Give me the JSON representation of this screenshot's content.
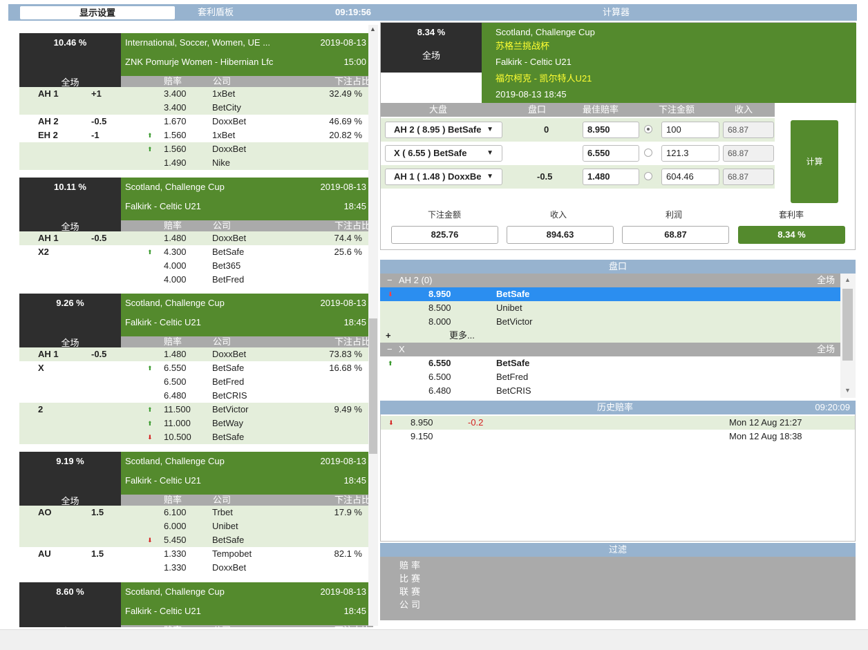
{
  "topbar": {
    "tab_display": "显示设置",
    "tab_arb": "套利盾板",
    "clock": "09:19:56",
    "calc_title": "计算器"
  },
  "colhdr": {
    "full": "全场",
    "odds": "赔率",
    "company": "公司",
    "share": "下注占比"
  },
  "blocks": [
    {
      "pct": "10.46 %",
      "league": "International, Soccer, Women, UE ...",
      "date": "2019-08-13",
      "match": "ZNK Pomurje Women - Hibernian Lfc",
      "time": "15:00",
      "rows": [
        {
          "mk": "AH 1",
          "ln": "+1",
          "arrow": "",
          "odds": "3.400",
          "book": "1xBet",
          "share": "32.49 %"
        },
        {
          "mk": "",
          "ln": "",
          "arrow": "",
          "odds": "3.400",
          "book": "BetCity",
          "share": ""
        },
        {
          "mk": "AH 2",
          "ln": "-0.5",
          "arrow": "",
          "odds": "1.670",
          "book": "DoxxBet",
          "share": "46.69 %"
        },
        {
          "mk": "EH 2",
          "ln": "-1",
          "arrow": "up",
          "odds": "1.560",
          "book": "1xBet",
          "share": "20.82 %"
        },
        {
          "mk": "",
          "ln": "",
          "arrow": "up",
          "odds": "1.560",
          "book": "DoxxBet",
          "share": ""
        },
        {
          "mk": "",
          "ln": "",
          "arrow": "",
          "odds": "1.490",
          "book": "Nike",
          "share": ""
        }
      ]
    },
    {
      "pct": "10.11 %",
      "league": "Scotland, Challenge Cup",
      "date": "2019-08-13",
      "match": "Falkirk - Celtic U21",
      "time": "18:45",
      "rows": [
        {
          "mk": "AH 1",
          "ln": "-0.5",
          "arrow": "",
          "odds": "1.480",
          "book": "DoxxBet",
          "share": "74.4 %"
        },
        {
          "mk": "X2",
          "ln": "",
          "arrow": "up",
          "odds": "4.300",
          "book": "BetSafe",
          "share": "25.6 %"
        },
        {
          "mk": "",
          "ln": "",
          "arrow": "",
          "odds": "4.000",
          "book": "Bet365",
          "share": ""
        },
        {
          "mk": "",
          "ln": "",
          "arrow": "",
          "odds": "4.000",
          "book": "BetFred",
          "share": ""
        }
      ]
    },
    {
      "pct": "9.26 %",
      "league": "Scotland, Challenge Cup",
      "date": "2019-08-13",
      "match": "Falkirk - Celtic U21",
      "time": "18:45",
      "rows": [
        {
          "mk": "AH 1",
          "ln": "-0.5",
          "arrow": "",
          "odds": "1.480",
          "book": "DoxxBet",
          "share": "73.83 %"
        },
        {
          "mk": "X",
          "ln": "",
          "arrow": "up",
          "odds": "6.550",
          "book": "BetSafe",
          "share": "16.68 %"
        },
        {
          "mk": "",
          "ln": "",
          "arrow": "",
          "odds": "6.500",
          "book": "BetFred",
          "share": ""
        },
        {
          "mk": "",
          "ln": "",
          "arrow": "",
          "odds": "6.480",
          "book": "BetCRIS",
          "share": ""
        },
        {
          "mk": "2",
          "ln": "",
          "arrow": "up",
          "odds": "11.500",
          "book": "BetVictor",
          "share": "9.49 %"
        },
        {
          "mk": "",
          "ln": "",
          "arrow": "up",
          "odds": "11.000",
          "book": "BetWay",
          "share": ""
        },
        {
          "mk": "",
          "ln": "",
          "arrow": "down",
          "odds": "10.500",
          "book": "BetSafe",
          "share": ""
        }
      ]
    },
    {
      "pct": "9.19 %",
      "league": "Scotland, Challenge Cup",
      "date": "2019-08-13",
      "match": "Falkirk - Celtic U21",
      "time": "18:45",
      "rows": [
        {
          "mk": "AO",
          "ln": "1.5",
          "arrow": "",
          "odds": "6.100",
          "book": "Trbet",
          "share": "17.9 %"
        },
        {
          "mk": "",
          "ln": "",
          "arrow": "",
          "odds": "6.000",
          "book": "Unibet",
          "share": ""
        },
        {
          "mk": "",
          "ln": "",
          "arrow": "down",
          "odds": "5.450",
          "book": "BetSafe",
          "share": ""
        },
        {
          "mk": "AU",
          "ln": "1.5",
          "arrow": "",
          "odds": "1.330",
          "book": "Tempobet",
          "share": "82.1 %"
        },
        {
          "mk": "",
          "ln": "",
          "arrow": "",
          "odds": "1.330",
          "book": "DoxxBet",
          "share": ""
        }
      ]
    },
    {
      "pct": "8.60 %",
      "league": "Scotland, Challenge Cup",
      "date": "2019-08-13",
      "match": "Falkirk - Celtic U21",
      "time": "18:45",
      "rows": []
    }
  ],
  "calc": {
    "pct": "8.34 %",
    "full": "全场",
    "league_en": "Scotland, Challenge Cup",
    "league_cn": "苏格兰挑战杯",
    "match_en": "Falkirk - Celtic U21",
    "match_cn": "福尔柯克 - 凯尔特人U21",
    "datetime": "2019-08-13 18:45",
    "hdr": {
      "market": "大盘",
      "line": "盘口",
      "best": "最佳赔率",
      "stake": "下注金额",
      "income": "收入"
    },
    "rows": [
      {
        "select": "AH 2 ( 8.95 ) BetSafe",
        "line": "0",
        "odds": "8.950",
        "stake": "100",
        "income": "68.87"
      },
      {
        "select": "X ( 6.55 ) BetSafe",
        "line": "",
        "odds": "6.550",
        "stake": "121.3",
        "income": "68.87"
      },
      {
        "select": "AH 1 ( 1.48 ) DoxxBe",
        "line": "-0.5",
        "odds": "1.480",
        "stake": "604.46",
        "income": "68.87"
      }
    ],
    "btn": "计算",
    "sum_hdr": {
      "stake": "下注金额",
      "income": "收入",
      "profit": "利润",
      "rate": "套利率"
    },
    "sum": {
      "stake": "825.76",
      "income": "894.63",
      "profit": "68.87",
      "rate": "8.34 %"
    }
  },
  "market": {
    "title": "盘口",
    "full": "全场",
    "g1": "AH 2 (0)",
    "g2": "X",
    "more": "更多...",
    "r": [
      {
        "odds": "8.950",
        "book": "BetSafe"
      },
      {
        "odds": "8.500",
        "book": "Unibet"
      },
      {
        "odds": "8.000",
        "book": "BetVictor"
      },
      {
        "odds": "6.550",
        "book": "BetSafe"
      },
      {
        "odds": "6.500",
        "book": "BetFred"
      },
      {
        "odds": "6.480",
        "book": "BetCRIS"
      }
    ]
  },
  "history": {
    "title": "历史赔率",
    "clock": "09:20:09",
    "rows": [
      {
        "odds": "8.950",
        "delta": "-0.2",
        "time": "Mon 12 Aug 21:27"
      },
      {
        "odds": "9.150",
        "delta": "",
        "time": "Mon 12 Aug 18:38"
      }
    ]
  },
  "filter": {
    "title": "过滤",
    "items": [
      "赔率",
      "比赛",
      "联赛",
      "公司"
    ]
  }
}
